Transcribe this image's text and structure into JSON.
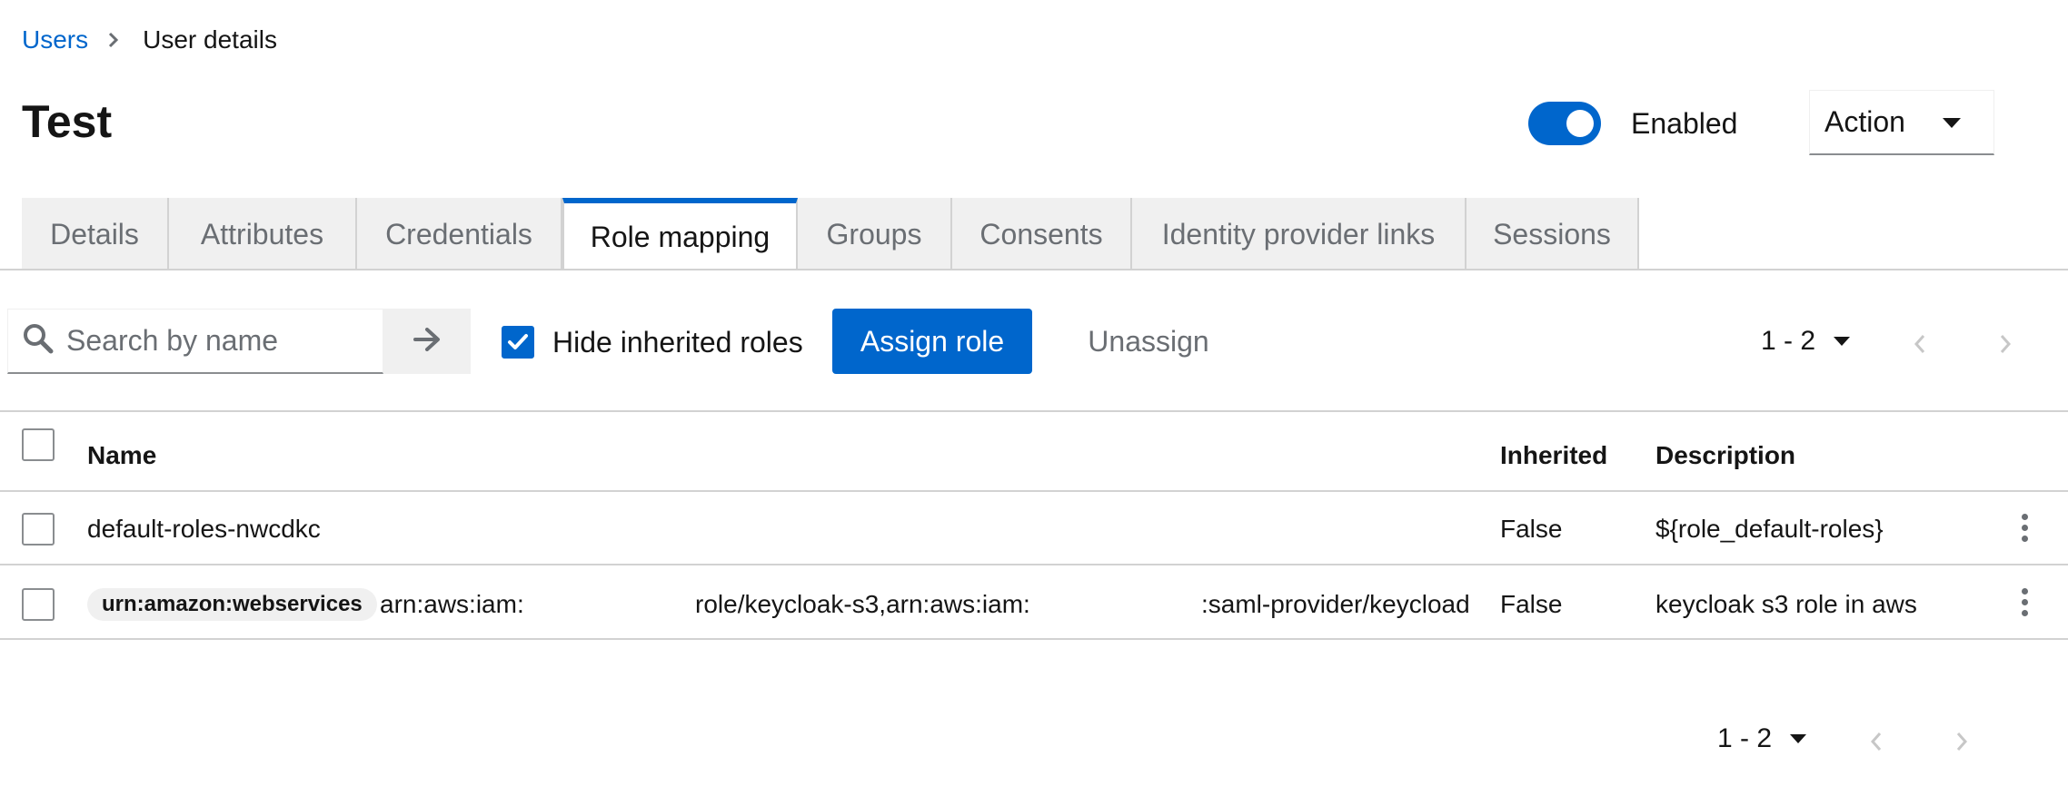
{
  "breadcrumb": {
    "parent": "Users",
    "current": "User details"
  },
  "page": {
    "title": "Test"
  },
  "header": {
    "enabled_label": "Enabled",
    "enabled": true,
    "action_label": "Action"
  },
  "tabs": [
    {
      "label": "Details",
      "active": false
    },
    {
      "label": "Attributes",
      "active": false
    },
    {
      "label": "Credentials",
      "active": false
    },
    {
      "label": "Role mapping",
      "active": true
    },
    {
      "label": "Groups",
      "active": false
    },
    {
      "label": "Consents",
      "active": false
    },
    {
      "label": "Identity provider links",
      "active": false
    },
    {
      "label": "Sessions",
      "active": false
    }
  ],
  "toolbar": {
    "search_placeholder": "Search by name",
    "hide_inherited_label": "Hide inherited roles",
    "hide_inherited_checked": true,
    "assign_label": "Assign role",
    "unassign_label": "Unassign"
  },
  "pagination": {
    "range": "1 - 2"
  },
  "table": {
    "headers": {
      "name": "Name",
      "inherited": "Inherited",
      "description": "Description"
    },
    "rows": [
      {
        "name": "default-roles-nwcdkc",
        "inherited": "False",
        "description": "${role_default-roles}"
      },
      {
        "badge": "urn:amazon:webservices",
        "name_part1": "arn:aws:iam:",
        "name_part2": "role/keycloak-s3,arn:aws:iam:",
        "name_part3": ":saml-provider/keycload",
        "inherited": "False",
        "description": "keycloak s3 role in aws"
      }
    ]
  },
  "colors": {
    "primary": "#0066cc",
    "border": "#d2d2d2",
    "muted": "#6a6e73",
    "tab_bg": "#f0f0f0"
  }
}
